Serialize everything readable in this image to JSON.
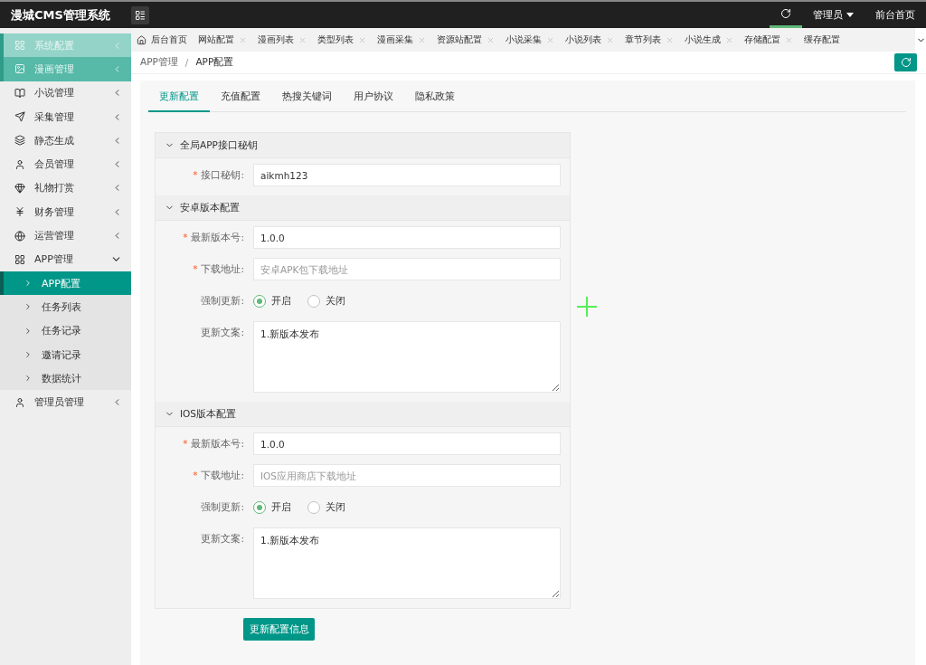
{
  "header": {
    "logo": "漫城CMS管理系统",
    "admin": "管理员",
    "frontpage": "前台首页"
  },
  "sidebar": {
    "items": [
      {
        "label": "系统配置",
        "highlighted": true,
        "selected": false,
        "expanded": false
      },
      {
        "label": "漫画管理",
        "highlighted": false,
        "selected": true,
        "expanded": false
      },
      {
        "label": "小说管理",
        "highlighted": false,
        "selected": false,
        "expanded": false
      },
      {
        "label": "采集管理",
        "highlighted": false,
        "selected": false,
        "expanded": false
      },
      {
        "label": "静态生成",
        "highlighted": false,
        "selected": false,
        "expanded": false
      },
      {
        "label": "会员管理",
        "highlighted": false,
        "selected": false,
        "expanded": false
      },
      {
        "label": "礼物打赏",
        "highlighted": false,
        "selected": false,
        "expanded": false
      },
      {
        "label": "财务管理",
        "highlighted": false,
        "selected": false,
        "expanded": false
      },
      {
        "label": "运营管理",
        "highlighted": false,
        "selected": false,
        "expanded": false
      },
      {
        "label": "APP管理",
        "highlighted": false,
        "selected": false,
        "expanded": true,
        "children": [
          {
            "label": "APP配置",
            "selected": true
          },
          {
            "label": "任务列表",
            "selected": false
          },
          {
            "label": "任务记录",
            "selected": false
          },
          {
            "label": "邀请记录",
            "selected": false
          },
          {
            "label": "数据统计",
            "selected": false
          }
        ]
      },
      {
        "label": "管理员管理",
        "highlighted": false,
        "selected": false,
        "expanded": false
      }
    ]
  },
  "tabs": [
    {
      "label": "后台首页",
      "kind": "home"
    },
    {
      "label": "网站配置",
      "kind": "closable"
    },
    {
      "label": "漫画列表",
      "kind": "closable"
    },
    {
      "label": "类型列表",
      "kind": "closable"
    },
    {
      "label": "漫画采集",
      "kind": "closable"
    },
    {
      "label": "资源站配置",
      "kind": "closable"
    },
    {
      "label": "小说采集",
      "kind": "closable"
    },
    {
      "label": "小说列表",
      "kind": "closable"
    },
    {
      "label": "章节列表",
      "kind": "closable"
    },
    {
      "label": "小说生成",
      "kind": "closable"
    },
    {
      "label": "存储配置",
      "kind": "closable"
    },
    {
      "label": "缓存配置",
      "kind": "plain"
    }
  ],
  "breadcrumb": [
    "APP管理",
    "APP配置"
  ],
  "breadcrumb_separator": "/",
  "subtabs": [
    {
      "label": "更新配置",
      "selected": true
    },
    {
      "label": "充值配置",
      "selected": false
    },
    {
      "label": "热搜关键词",
      "selected": false
    },
    {
      "label": "用户协议",
      "selected": false
    },
    {
      "label": "隐私政策",
      "selected": false
    }
  ],
  "sections": [
    {
      "title": "全局APP接口秘钥",
      "fields": [
        {
          "kind": "input",
          "label": "接口秘钥:",
          "required_mark": "*",
          "value": "aikmh123"
        }
      ]
    },
    {
      "title": "安卓版本配置",
      "fields": [
        {
          "kind": "input",
          "label": "最新版本号:",
          "required_mark": "*",
          "value": "1.0.0"
        },
        {
          "kind": "input",
          "label": "下载地址:",
          "required_mark": "*",
          "placeholder": "安卓APK包下载地址"
        },
        {
          "kind": "radio",
          "label": "强制更新:",
          "options": [
            {
              "label": "开启",
              "selected": true
            },
            {
              "label": "关闭",
              "selected": false
            }
          ]
        },
        {
          "kind": "textarea",
          "label": "更新文案:",
          "value": "1.新版本发布"
        }
      ]
    },
    {
      "title": "IOS版本配置",
      "fields": [
        {
          "kind": "input",
          "label": "最新版本号:",
          "required_mark": "*",
          "value": "1.0.0"
        },
        {
          "kind": "input",
          "label": "下载地址:",
          "required_mark": "*",
          "placeholder": "IOS应用商店下载地址"
        },
        {
          "kind": "radio",
          "label": "强制更新:",
          "options": [
            {
              "label": "开启",
              "selected": true
            },
            {
              "label": "关闭",
              "selected": false
            }
          ]
        },
        {
          "kind": "textarea",
          "label": "更新文案:",
          "value": "1.新版本发布"
        }
      ]
    }
  ],
  "submit": "更新配置信息"
}
